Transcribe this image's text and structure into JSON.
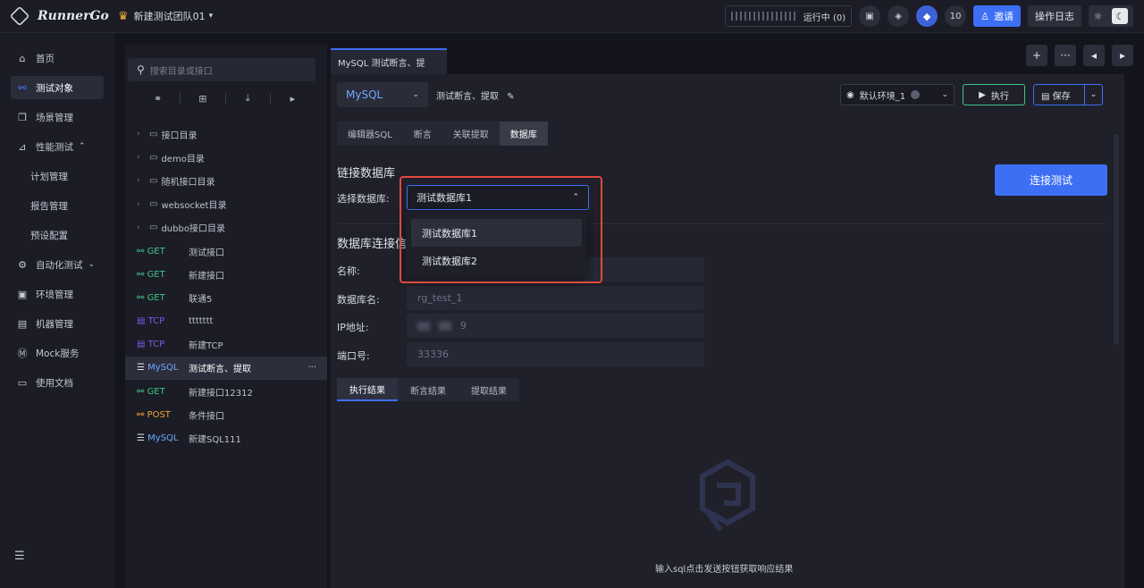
{
  "brand": {
    "name": "RunnerGo"
  },
  "team": {
    "name": "新建测试团队01"
  },
  "topbar": {
    "run_status": "运行中 (0)",
    "member_count": "10",
    "invite_label": "邀请",
    "log_label": "操作日志"
  },
  "nav": {
    "items": [
      {
        "label": "首页",
        "icon": "home-icon"
      },
      {
        "label": "测试对象",
        "icon": "link-icon"
      },
      {
        "label": "场景管理",
        "icon": "copy-icon"
      },
      {
        "label": "性能测试",
        "icon": "chart-icon"
      },
      {
        "label": "计划管理"
      },
      {
        "label": "报告管理"
      },
      {
        "label": "预设配置"
      },
      {
        "label": "自动化测试",
        "icon": "robot-icon"
      },
      {
        "label": "环境管理",
        "icon": "env-icon"
      },
      {
        "label": "机器管理",
        "icon": "server-icon"
      },
      {
        "label": "Mock服务",
        "icon": "mock-icon"
      },
      {
        "label": "使用文档",
        "icon": "doc-icon"
      }
    ]
  },
  "directory": {
    "search_placeholder": "搜索目录或接口",
    "folders": [
      "接口目录",
      "demo目录",
      "随机接口目录",
      "websocket目录",
      "dubbo接口目录"
    ],
    "apis": [
      {
        "method": "GET",
        "name": "测试接口"
      },
      {
        "method": "GET",
        "name": "新建接口"
      },
      {
        "method": "GET",
        "name": "联通5"
      },
      {
        "method": "TCP",
        "name": "ttttttt"
      },
      {
        "method": "TCP",
        "name": "新建TCP"
      },
      {
        "method": "MySQL",
        "name": "测试断言、提取"
      },
      {
        "method": "GET",
        "name": "新建接口12312"
      },
      {
        "method": "POST",
        "name": "条件接口"
      },
      {
        "method": "MySQL",
        "name": "新建SQL111"
      }
    ]
  },
  "tab": {
    "label": "MySQL 测试断言、提"
  },
  "editor": {
    "protocol": "MySQL",
    "api_title": "测试断言、提取",
    "env": "默认环境_1",
    "exec_label": "执行",
    "save_label": "保存",
    "subtabs": [
      "编辑器SQL",
      "断言",
      "关联提取",
      "数据库"
    ],
    "section_title": "链接数据库",
    "select_label": "选择数据库:",
    "selected_db": "测试数据库1",
    "connect_label": "连接测试",
    "conn_section_title": "数据库连接信息",
    "fields": [
      {
        "label": "名称:",
        "value": ""
      },
      {
        "label": "数据库名:",
        "value": "rg_test_1"
      },
      {
        "label": "IP地址:",
        "value": "9"
      },
      {
        "label": "端口号:",
        "value": "33336"
      }
    ],
    "result_tabs": [
      "执行结果",
      "断言结果",
      "提取结果"
    ],
    "empty_text": "输入sql点击发送按钮获取响应结果"
  },
  "dropdown": {
    "options": [
      "测试数据库1",
      "测试数据库2"
    ]
  },
  "colors": {
    "accent": "#3d6ff5",
    "get": "#3fc68a",
    "tcp": "#7a5cf0",
    "mysql": "#6fa6ff",
    "post": "#f0a13a",
    "highlight": "#e0493e"
  }
}
